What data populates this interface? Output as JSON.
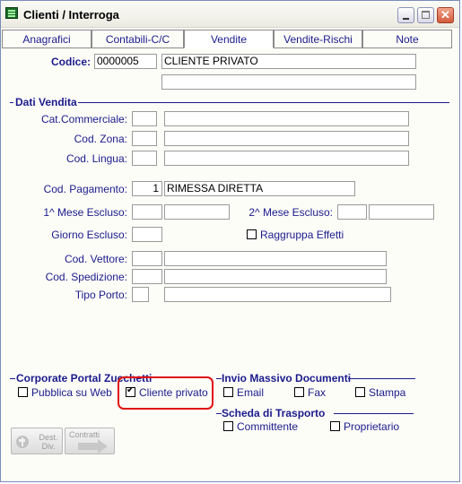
{
  "window": {
    "title": "Clienti / Interroga"
  },
  "tabs": [
    "Anagrafici",
    "Contabili-C/C",
    "Vendite",
    "Vendite-Rischi",
    "Note"
  ],
  "header": {
    "codice_label": "Codice:",
    "codice_value": "0000005",
    "name_value": "CLIENTE PRIVATO",
    "name2_value": ""
  },
  "dati_vendita": {
    "title": "Dati Vendita",
    "cat_commerciale_label": "Cat.Commerciale:",
    "cod_zona_label": "Cod. Zona:",
    "cod_lingua_label": "Cod. Lingua:",
    "cod_pagamento_label": "Cod. Pagamento:",
    "cod_pagamento_value": "1",
    "cod_pagamento_desc": "RIMESSA DIRETTA",
    "mese_escluso_1_label": "1^ Mese Escluso:",
    "mese_escluso_2_label": "2^ Mese Escluso:",
    "giorno_escluso_label": "Giorno Escluso:",
    "raggruppa_effetti_label": "Raggruppa Effetti",
    "cod_vettore_label": "Cod. Vettore:",
    "cod_spedizione_label": "Cod. Spedizione:",
    "tipo_porto_label": "Tipo Porto:"
  },
  "corporate_portal": {
    "title": "Corporate Portal Zucchetti",
    "pubblica_label": "Pubblica su Web",
    "cliente_privato_label": "Cliente privato",
    "cliente_privato_checked": true
  },
  "invio_massivo": {
    "title": "Invio Massivo Documenti",
    "email_label": "Email",
    "fax_label": "Fax",
    "stampa_label": "Stampa"
  },
  "scheda_trasporto": {
    "title": "Scheda di Trasporto",
    "committente_label": "Committente",
    "proprietario_label": "Proprietario"
  },
  "buttons": {
    "dest_div_label": "Dest. Div.",
    "contratti_label": "Contratti"
  },
  "icons": [
    "app-icon",
    "minimize-icon",
    "maximize-icon",
    "close-icon",
    "destinations-icon",
    "contracts-icon"
  ]
}
